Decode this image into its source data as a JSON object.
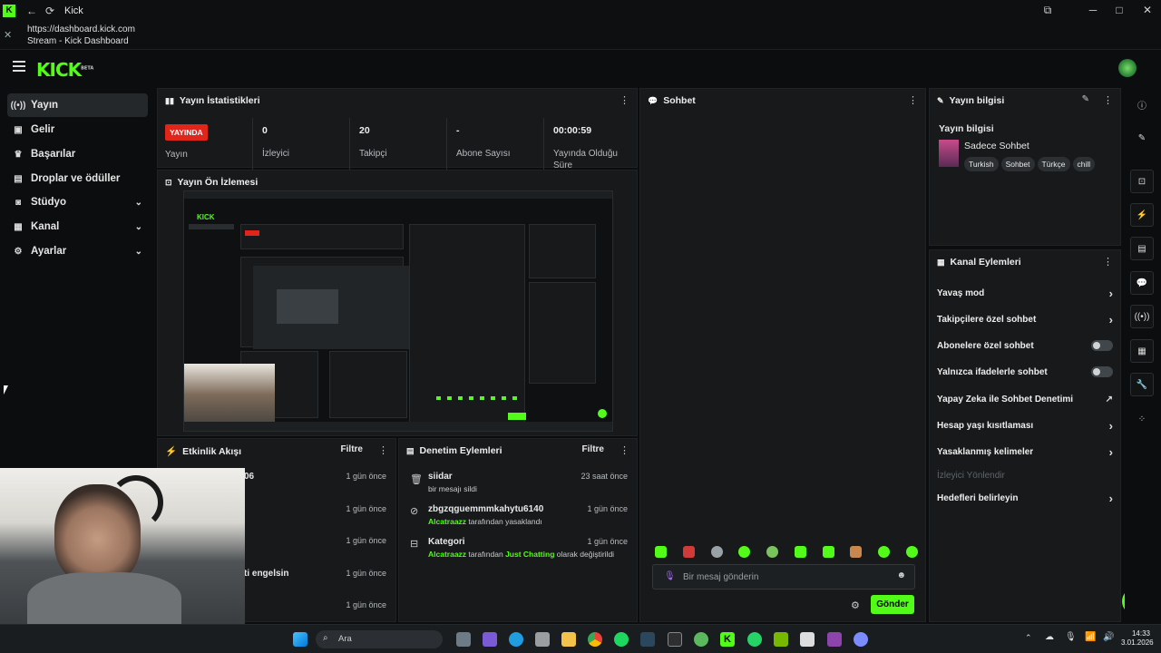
{
  "window": {
    "title": "Kick",
    "url": "https://dashboard.kick.com",
    "page_title": "Stream - Kick Dashboard"
  },
  "brand": {
    "logo": "KICK",
    "logo_sup": "BETA",
    "accent": "#53fc18"
  },
  "sidebar": {
    "items": [
      {
        "label": "Yayın",
        "icon": "broadcast-icon",
        "active": true
      },
      {
        "label": "Gelir",
        "icon": "wallet-icon"
      },
      {
        "label": "Başarılar",
        "icon": "trophy-icon"
      },
      {
        "label": "Droplar ve ödüller",
        "icon": "gift-icon"
      },
      {
        "label": "Stüdyo",
        "icon": "studio-icon",
        "expandable": true
      },
      {
        "label": "Kanal",
        "icon": "channel-icon",
        "expandable": true
      },
      {
        "label": "Ayarlar",
        "icon": "gear-icon",
        "expandable": true
      }
    ]
  },
  "stats": {
    "title": "Yayın İstatistikleri",
    "live_badge": "YAYINDA",
    "live_label": "Yayın",
    "items": [
      {
        "value": "0",
        "label": "İzleyici"
      },
      {
        "value": "20",
        "label": "Takipçi"
      },
      {
        "value": "-",
        "label": "Abone Sayısı"
      },
      {
        "value": "00:00:59",
        "label": "Yayında Olduğu Süre"
      }
    ]
  },
  "preview": {
    "title": "Yayın Ön İzlemesi"
  },
  "activity": {
    "title": "Etkinlik Akışı",
    "filter": "Filtre",
    "rows": [
      {
        "text": "06",
        "when": "1 gün önce"
      },
      {
        "text": "",
        "when": "1 gün önce"
      },
      {
        "text": "",
        "when": "1 gün önce"
      },
      {
        "text": "ti engelsin",
        "when": "1 gün önce"
      },
      {
        "text": "",
        "when": "1 gün önce"
      }
    ]
  },
  "moderation": {
    "title": "Denetim Eylemleri",
    "filter": "Filtre",
    "rows": [
      {
        "icon": "trash-icon",
        "name": "siidar",
        "detail_a": "",
        "detail_b": "bir mesajı sildi",
        "detail_c": "",
        "detail_d": "",
        "when": "23 saat önce"
      },
      {
        "icon": "ban-icon",
        "name": "zbgzqguemmmkahytu6140",
        "detail_a": "Alcatraazz",
        "detail_b": " tarafından yasaklandı",
        "detail_c": "",
        "detail_d": "",
        "when": "1 gün önce"
      },
      {
        "icon": "category-icon",
        "name": "Kategori",
        "detail_a": "Alcatraazz",
        "detail_b": " tarafından ",
        "detail_c": "Just Chatting",
        "detail_d": " olarak değiştirildi",
        "when": "1 gün önce"
      }
    ]
  },
  "chat": {
    "title": "Sohbet",
    "placeholder": "Bir mesaj gönderin",
    "send": "Gönder"
  },
  "stream_info": {
    "title": "Yayın bilgisi",
    "subtitle": "Yayın bilgisi",
    "stream_title": "Sadece Sohbet",
    "tags": [
      "Turkish",
      "Sohbet",
      "Türkçe",
      "chill"
    ]
  },
  "channel_actions": {
    "title": "Kanal Eylemleri",
    "items": [
      {
        "label": "Yavaş mod",
        "control": "arrow"
      },
      {
        "label": "Takipçilere özel sohbet",
        "control": "arrow"
      },
      {
        "label": "Abonelere özel sohbet",
        "control": "toggle"
      },
      {
        "label": "Yalnızca ifadelerle sohbet",
        "control": "toggle"
      },
      {
        "label": "Yapay Zeka ile Sohbet Denetimi",
        "control": "external"
      },
      {
        "label": "Hesap yaşı kısıtlaması",
        "control": "arrow"
      },
      {
        "label": "Yasaklanmış kelimeler",
        "control": "arrow"
      },
      {
        "label": "İzleyici Yönlendir",
        "control": "none",
        "disabled": true
      },
      {
        "label": "Hedefleri belirleyin",
        "control": "arrow"
      }
    ]
  },
  "taskbar": {
    "search": "Ara",
    "time": "14:33",
    "date": "3.01.2026"
  }
}
